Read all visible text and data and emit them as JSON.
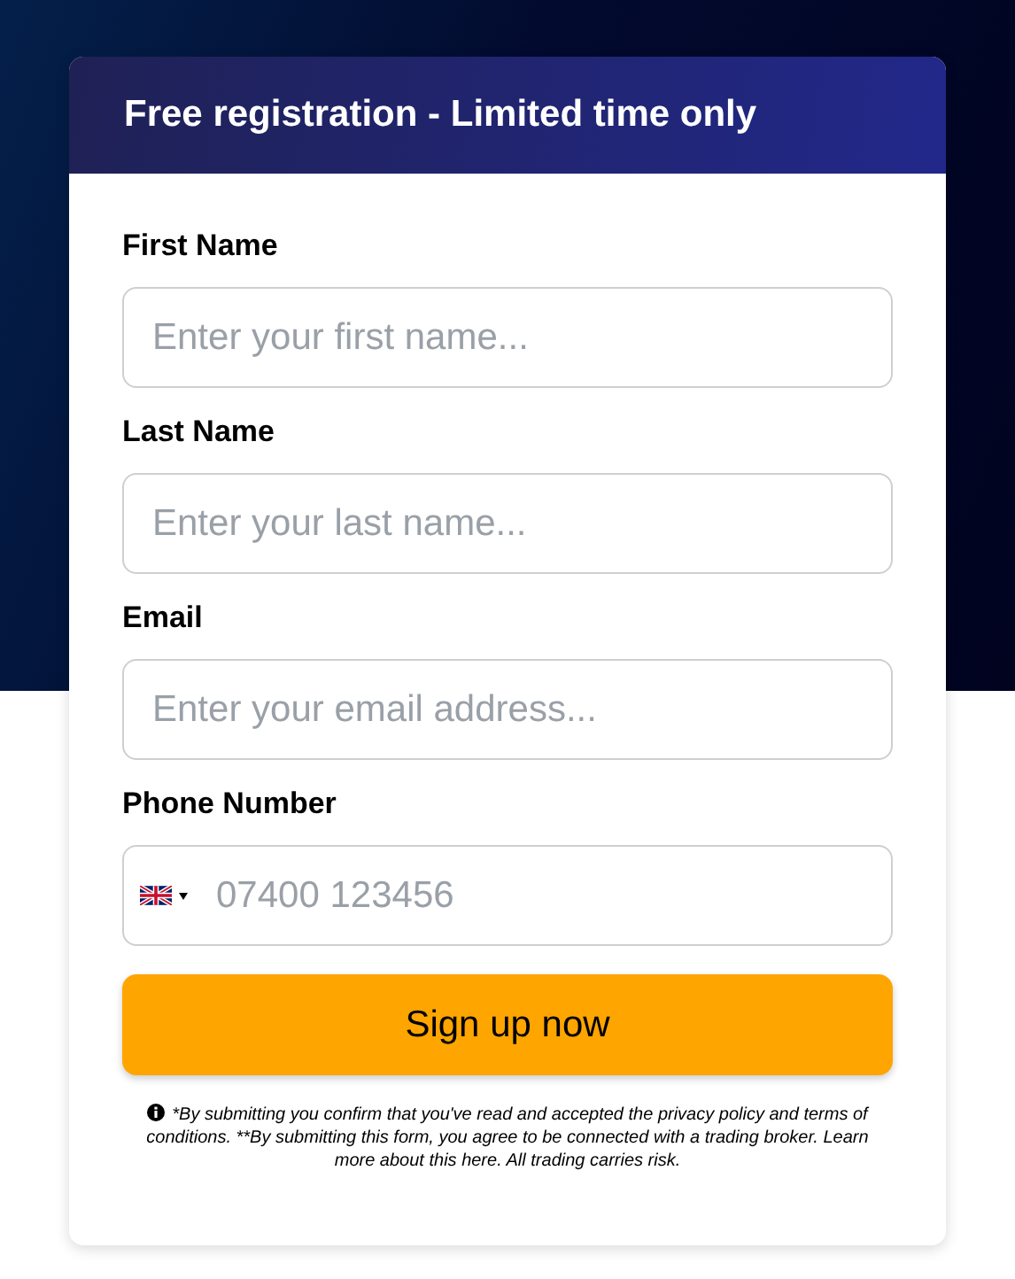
{
  "header": {
    "title": "Free registration - Limited time only"
  },
  "fields": [
    {
      "kind": "text",
      "label": "First Name",
      "placeholder": "Enter your first name..."
    },
    {
      "kind": "text",
      "label": "Last Name",
      "placeholder": "Enter your last name..."
    },
    {
      "kind": "text",
      "label": "Email",
      "placeholder": "Enter your email address..."
    },
    {
      "kind": "phone",
      "label": "Phone Number",
      "placeholder": "07400 123456"
    }
  ],
  "submit_button": "Sign up now",
  "disclaimer": "*By submitting you confirm that you've read and accepted the privacy policy and terms of conditions. **By submitting this form, you agree to be connected with a trading broker. Learn more about this here. All trading carries risk."
}
